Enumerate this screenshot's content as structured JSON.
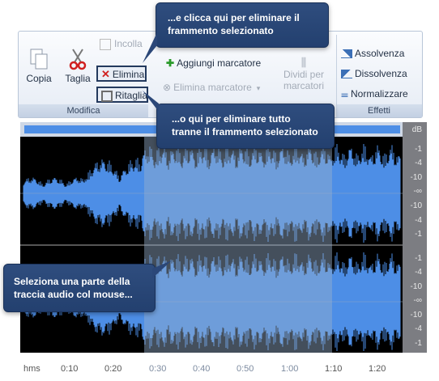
{
  "ribbon": {
    "groups": {
      "modifica": "Modifica",
      "effetti": "Effetti"
    },
    "buttons": {
      "copia": "Copia",
      "taglia": "Taglia",
      "incolla": "Incolla",
      "elimina": "Elimina",
      "ritaglia": "Ritaglia",
      "aggiungi_marcatore": "Aggiungi marcatore",
      "elimina_marcatore": "Elimina marcatore",
      "dividi_line1": "Dividi per",
      "dividi_line2": "marcatori",
      "assolvenza": "Assolvenza",
      "dissolvenza": "Dissolvenza",
      "normalizzare": "Normalizzare"
    }
  },
  "editor": {
    "db_unit": "dB",
    "db_labels_top": [
      "-1",
      "-4",
      "-10",
      "-∞",
      "-10",
      "-4",
      "-1"
    ],
    "db_labels_bottom": [
      "-1",
      "-4",
      "-10",
      "-∞",
      "-10",
      "-4",
      "-1"
    ],
    "time_unit": "hms",
    "time_labels": [
      "0:10",
      "0:20",
      "0:30",
      "0:40",
      "0:50",
      "1:00",
      "1:10",
      "1:20"
    ]
  },
  "callouts": {
    "elimina_line1": "...e clicca qui per eliminare il",
    "elimina_line2": "frammento selezionato",
    "ritaglia_line1": "...o qui per eliminare tutto",
    "ritaglia_line2": "tranne il frammento selezionato",
    "select_line1": "Seleziona una parte della",
    "select_line2": "traccia audio col mouse..."
  },
  "colors": {
    "waveform": "#4d8ee6",
    "callout": "#2b4778",
    "selection": "#8ea6c4"
  }
}
